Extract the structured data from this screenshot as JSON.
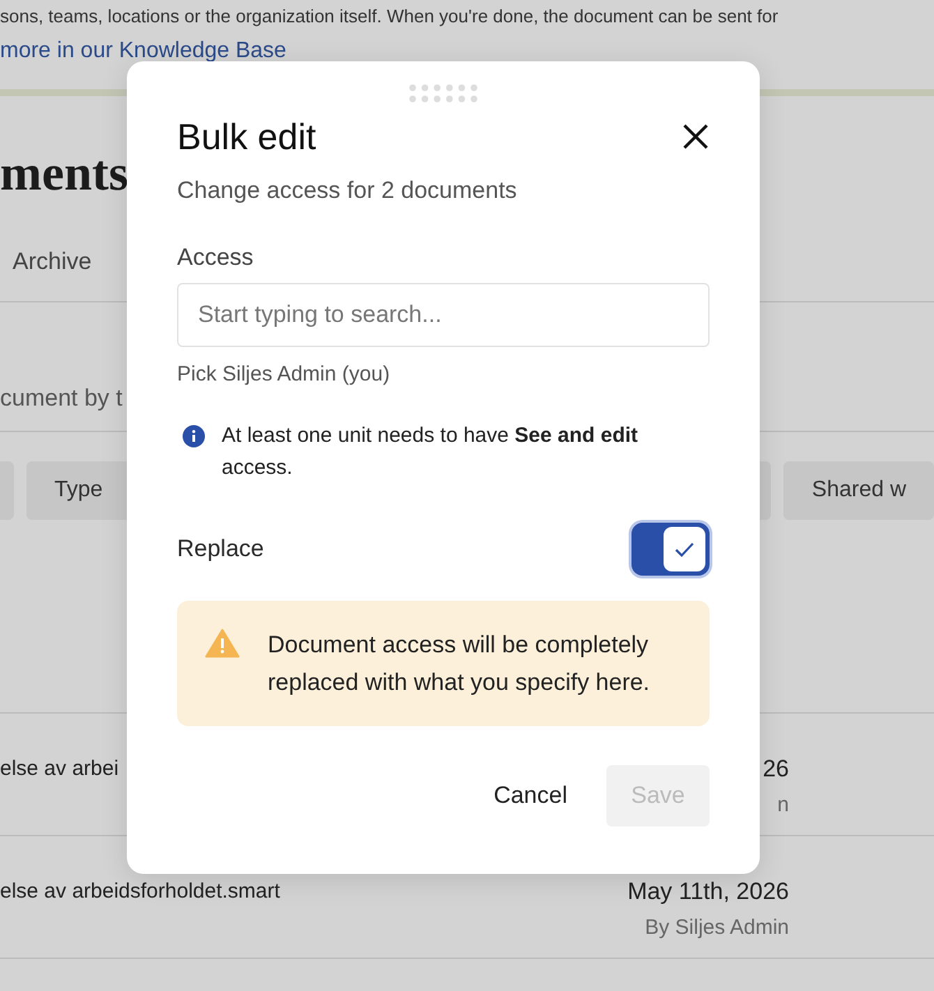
{
  "background": {
    "intro_text": "sons, teams, locations or the organization itself. When you're done, the document can be sent for",
    "link": "more in our Knowledge Base",
    "heading": "ments",
    "tabs": [
      {
        "label": "Archive",
        "selected": false
      }
    ],
    "search": {
      "placeholder": "cument by t"
    },
    "filters": [
      {
        "kind": "blank"
      },
      {
        "kind": "label",
        "label": "Type"
      },
      {
        "kind": "caret"
      },
      {
        "kind": "label",
        "label": "Shared w"
      }
    ],
    "rows": [
      {
        "name": "else av arbei",
        "date": "26",
        "author": "n"
      },
      {
        "name": "else av arbeidsforholdet.smart",
        "date": "May 11th, 2026",
        "author": "By Siljes Admin"
      }
    ]
  },
  "dialog": {
    "title": "Bulk edit",
    "subtitle": "Change access for 2 documents",
    "access_label": "Access",
    "access_field": {
      "placeholder": "Start typing to search..."
    },
    "pick_prefix": "Pick",
    "pick_link": "Siljes Admin (you)",
    "info": "At least one unit needs to have **See and edit** access.",
    "replace": {
      "label": "Replace",
      "on": true
    },
    "warning": "Document access will be completely replaced with what you specify here.",
    "buttons": [
      {
        "label": "Cancel",
        "kind": "link",
        "disabled": false
      },
      {
        "label": "Save",
        "kind": "primary",
        "disabled": true
      }
    ]
  }
}
